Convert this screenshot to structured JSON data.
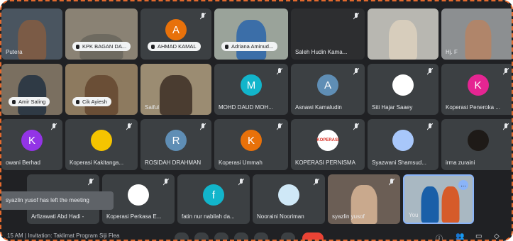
{
  "row1": [
    {
      "name": "Putera",
      "style": "plain"
    },
    {
      "name": "KPK BAGAN DA...",
      "style": "pill"
    },
    {
      "name": "AHMAD KAMAL",
      "style": "pill",
      "letter": "A",
      "color": "#e8710a"
    },
    {
      "name": "Adriana Aminud...",
      "style": "pill"
    },
    {
      "name": "Saleh Hudin Kama...",
      "style": "plain"
    },
    {
      "name": "",
      "style": "plain"
    },
    {
      "name": "Hj. F",
      "style": "plain"
    }
  ],
  "row2": [
    {
      "name": "Amir Saling",
      "style": "pill"
    },
    {
      "name": "Cik Ayiesh",
      "style": "pill"
    },
    {
      "name": "Saiful",
      "style": "plain"
    },
    {
      "name": "MOHD DAUD MOH...",
      "style": "plain",
      "letter": "M",
      "color": "#12b5cb"
    },
    {
      "name": "Asnawi Kamaludin",
      "style": "plain",
      "letter": "A",
      "color": "#5f8eb5"
    },
    {
      "name": "Siti Hajar Saaey",
      "style": "plain"
    },
    {
      "name": "Koperasi Peneroka ...",
      "style": "plain",
      "letter": "K",
      "color": "#e52592"
    }
  ],
  "row3": [
    {
      "name": "owani Berhad",
      "style": "plain",
      "letter": "K",
      "color": "#9334e6"
    },
    {
      "name": "Koperasi Kakitanga...",
      "style": "plain"
    },
    {
      "name": "ROSIDAH DRAHMAN",
      "style": "plain",
      "letter": "R",
      "color": "#5f8eb5"
    },
    {
      "name": "Koperasi Ummah",
      "style": "plain",
      "letter": "K",
      "color": "#e8710a"
    },
    {
      "name": "KOPERASI PERNISMA",
      "style": "plain",
      "logo_text": "KOPERASI"
    },
    {
      "name": "Syazwani Shamsud...",
      "style": "plain"
    },
    {
      "name": "irma zuraini",
      "style": "plain"
    }
  ],
  "row4": [
    {
      "name": "Arfizawati Abd Hadi -",
      "style": "plain"
    },
    {
      "name": "Koperasi Perkasa E...",
      "style": "plain"
    },
    {
      "name": "fatin nur nabilah da...",
      "style": "plain",
      "letter": "f",
      "color": "#12b5cb"
    },
    {
      "name": "Nooraini Nooriman",
      "style": "plain"
    },
    {
      "name": "syazlin yusof",
      "style": "plain"
    },
    {
      "name": "You",
      "style": "you"
    }
  ],
  "toast": "syazlin yusof has left the meeting",
  "bottom": {
    "time_meeting": "15 AM | Invitation: Taklimat Program Siji Flea",
    "more": "..."
  }
}
